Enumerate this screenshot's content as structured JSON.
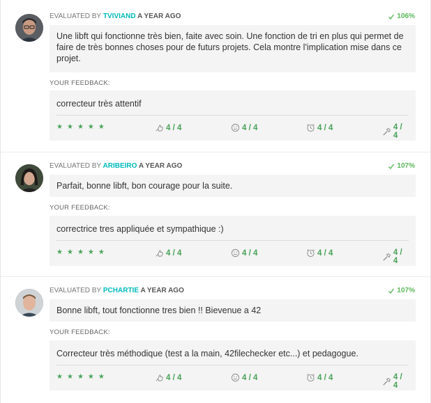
{
  "labels": {
    "evaluated_by": "EVALUATED BY",
    "your_feedback": "YOUR FEEDBACK:"
  },
  "colors": {
    "login": "#00babc",
    "score": "#5cb85c",
    "rating": "#4aa35a"
  },
  "evaluations": [
    {
      "login": "TVIVIAND",
      "time": "A YEAR AGO",
      "score": "106%",
      "comment": "Une libft qui fonctionne très bien, faite avec soin. Une fonction de tri en plus qui permet de faire de très bonnes choses pour de futurs projets. Cela montre l'implication mise dans ce projet.",
      "feedback": "correcteur très attentif",
      "stars": 5,
      "ratings": {
        "nice": "4 / 4",
        "friendly": "4 / 4",
        "punctual": "4 / 4",
        "rigorous": "4 / 4"
      }
    },
    {
      "login": "ARIBEIRO",
      "time": "A YEAR AGO",
      "score": "107%",
      "comment": "Parfait, bonne libft, bon courage pour la suite.",
      "feedback": "correctrice tres appliquée et sympathique :)",
      "stars": 5,
      "ratings": {
        "nice": "4 / 4",
        "friendly": "4 / 4",
        "punctual": "4 / 4",
        "rigorous": "4 / 4"
      }
    },
    {
      "login": "PCHARTIE",
      "time": "A YEAR AGO",
      "score": "107%",
      "comment": "Bonne libft, tout fonctionne tres bien !! Bievenue a 42",
      "feedback": "Correcteur très méthodique (test a la main, 42filechecker etc...) et pedagogue.",
      "stars": 5,
      "ratings": {
        "nice": "4 / 4",
        "friendly": "4 / 4",
        "punctual": "4 / 4",
        "rigorous": "4 / 4"
      }
    }
  ]
}
